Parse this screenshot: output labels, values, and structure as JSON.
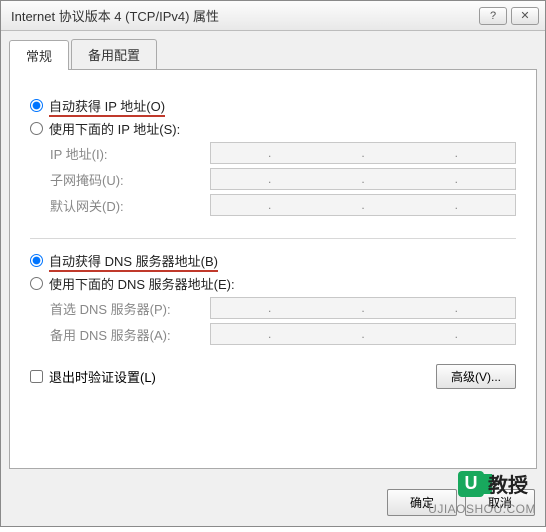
{
  "window": {
    "title": "Internet 协议版本 4 (TCP/IPv4) 属性",
    "help_icon": "?",
    "close_icon": "✕"
  },
  "tabs": {
    "general": "常规",
    "alternate": "备用配置"
  },
  "ip_section": {
    "auto_label": "自动获得 IP 地址(O)",
    "manual_label": "使用下面的 IP 地址(S):",
    "ip_address_label": "IP 地址(I):",
    "subnet_label": "子网掩码(U):",
    "gateway_label": "默认网关(D):"
  },
  "dns_section": {
    "auto_label": "自动获得 DNS 服务器地址(B)",
    "manual_label": "使用下面的 DNS 服务器地址(E):",
    "preferred_label": "首选 DNS 服务器(P):",
    "alternate_label": "备用 DNS 服务器(A):"
  },
  "validate_label": "退出时验证设置(L)",
  "advanced_button": "高级(V)...",
  "footer": {
    "ok": "确定",
    "cancel": "取消"
  },
  "watermark": {
    "badge_letter": "U",
    "brand": "教授",
    "url": "UJIAOSHOU.COM"
  }
}
